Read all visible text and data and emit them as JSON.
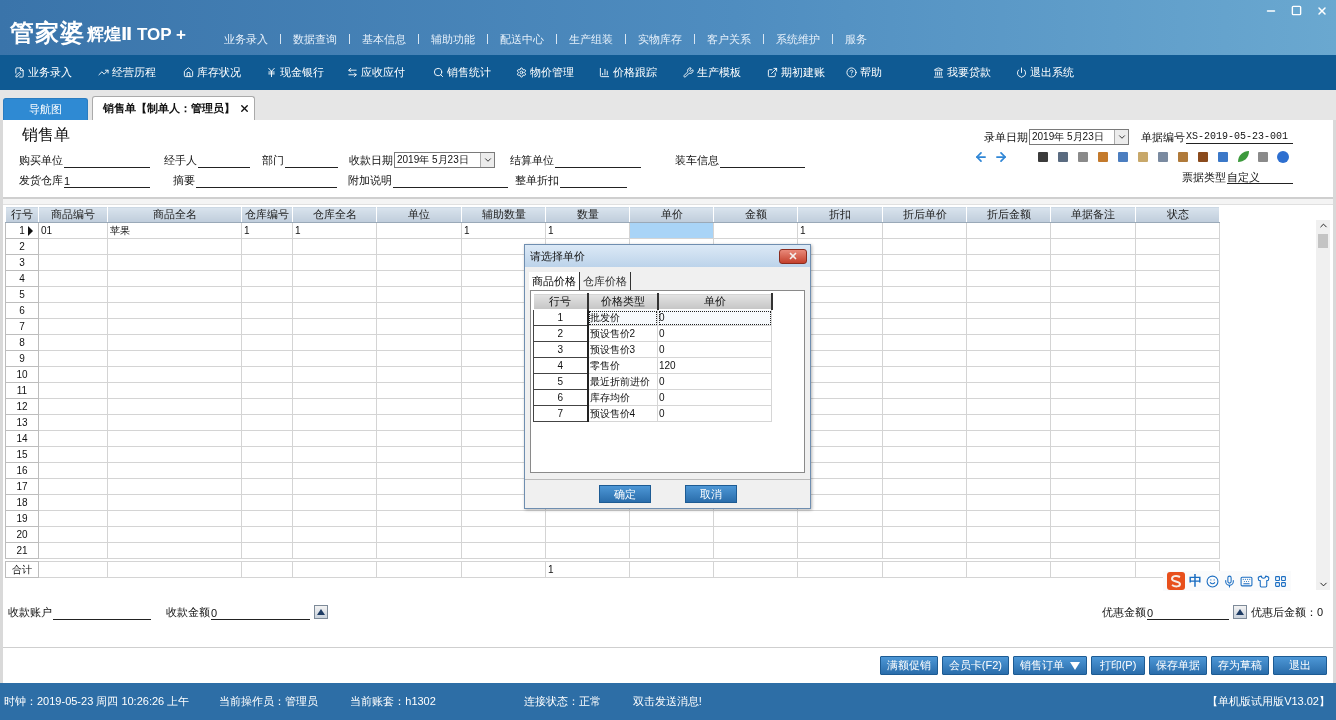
{
  "header": {
    "logo": "管家婆",
    "product": "辉煌Ⅱ TOP +",
    "menu": [
      "业务录入",
      "数据查询",
      "基本信息",
      "辅助功能",
      "配送中心",
      "生产组装",
      "实物库存",
      "客户关系",
      "系统维护",
      "服务"
    ]
  },
  "toolbar": [
    "业务录入",
    "经营历程",
    "库存状况",
    "现金银行",
    "应收应付",
    "销售统计",
    "物价管理",
    "价格跟踪",
    "生产模板",
    "期初建账",
    "帮助",
    "我要贷款",
    "退出系统"
  ],
  "tabs": [
    {
      "label": "导航图",
      "selected": false,
      "closable": false
    },
    {
      "label": "销售单【制单人：管理员】",
      "selected": true,
      "closable": true
    }
  ],
  "form": {
    "title": "销售单",
    "fields": [
      {
        "label": "购买单位",
        "kind": "line"
      },
      {
        "label": "经手人",
        "kind": "line"
      },
      {
        "label": "部门",
        "kind": "line"
      },
      {
        "label": "收款日期",
        "kind": "date",
        "value": "2019年 5月23日"
      },
      {
        "label": "结算单位",
        "kind": "line"
      },
      {
        "label": "装车信息",
        "kind": "line"
      },
      {
        "label": "发货仓库",
        "kind": "line",
        "value": "1"
      },
      {
        "label": "摘要",
        "kind": "line"
      },
      {
        "label": "附加说明",
        "kind": "line"
      },
      {
        "label": "整单折扣",
        "kind": "line"
      }
    ],
    "entry_date": {
      "label": "录单日期",
      "value": "2019年 5月23日"
    },
    "bill_number": {
      "label": "单据编号",
      "value": "XS-2019-05-23-001"
    },
    "bill_type": {
      "label": "票据类型",
      "value": "自定义"
    }
  },
  "grid": {
    "columns": [
      "行号",
      "商品编号",
      "商品全名",
      "仓库编号",
      "仓库全名",
      "单位",
      "辅助数量",
      "数量",
      "单价",
      "金额",
      "折扣",
      "折后单价",
      "折后金额",
      "单据备注",
      "状态"
    ],
    "rows": [
      {
        "number": "1",
        "current": true,
        "cells": [
          {
            "text": "01",
            "selected": false
          },
          {
            "text": "苹果",
            "selected": false
          },
          {
            "text": "1",
            "selected": false
          },
          {
            "text": "1",
            "selected": false
          },
          {
            "selected": false
          },
          {
            "text": "1",
            "selected": false
          },
          {
            "text": "1",
            "selected": false
          },
          {
            "selected": true
          },
          {
            "selected": false
          },
          {
            "text": "1",
            "selected": false
          },
          {
            "selected": false
          },
          {
            "selected": false
          },
          {
            "selected": false
          },
          {
            "selected": false
          }
        ]
      },
      {
        "number": "2",
        "current": false
      },
      {
        "number": "3",
        "current": false
      },
      {
        "number": "4",
        "current": false
      },
      {
        "number": "5",
        "current": false
      },
      {
        "number": "6",
        "current": false
      },
      {
        "number": "7",
        "current": false
      },
      {
        "number": "8",
        "current": false
      },
      {
        "number": "9",
        "current": false
      },
      {
        "number": "10",
        "current": false
      },
      {
        "number": "11",
        "current": false
      },
      {
        "number": "12",
        "current": false
      },
      {
        "number": "13",
        "current": false
      },
      {
        "number": "14",
        "current": false
      },
      {
        "number": "15",
        "current": false
      },
      {
        "number": "16",
        "current": false
      },
      {
        "number": "17",
        "current": false
      },
      {
        "number": "18",
        "current": false
      },
      {
        "number": "19",
        "current": false
      },
      {
        "number": "20",
        "current": false
      },
      {
        "number": "21",
        "current": false
      }
    ],
    "totals": {
      "label": "合计",
      "cells": [
        {},
        {},
        {},
        {},
        {},
        {},
        {
          "text": "1"
        },
        {},
        {},
        {},
        {},
        {},
        {},
        {}
      ]
    }
  },
  "payment": {
    "left": [
      {
        "label": "收款账户",
        "kind": "line"
      },
      {
        "label": "收款金额",
        "kind": "spin",
        "value": "0"
      }
    ],
    "right": [
      {
        "label": "优惠金额",
        "kind": "spin",
        "value": "0"
      },
      {
        "kind": "readout",
        "text": "优惠后金额：0"
      }
    ]
  },
  "buttons": [
    {
      "label": "满额促销",
      "dropdown": false
    },
    {
      "label": "会员卡(F2)",
      "dropdown": false
    },
    {
      "label": "销售订单",
      "dropdown": true
    },
    {
      "label": "打印(P)",
      "dropdown": false
    },
    {
      "label": "保存单据",
      "dropdown": false
    },
    {
      "label": "存为草稿",
      "dropdown": false
    },
    {
      "label": "退出",
      "dropdown": false
    }
  ],
  "status_bar": [
    "时钟：2019-05-23 周四 10:26:26 上午",
    "当前操作员：管理员",
    "当前账套：h1302",
    "连接状态：正常",
    "双击发送消息!"
  ],
  "edition": "【单机版试用版V13.02】",
  "ime": {
    "label": "中"
  },
  "dialog": {
    "title": "请选择单价",
    "tabs": [
      {
        "label": "商品价格",
        "selected": true
      },
      {
        "label": "仓库价格",
        "selected": false
      }
    ],
    "columns": [
      "行号",
      "价格类型",
      "单价"
    ],
    "rows": [
      {
        "number": "1",
        "type": "批发价",
        "price": "0",
        "selected": true
      },
      {
        "number": "2",
        "type": "预设售价2",
        "price": "0",
        "selected": false
      },
      {
        "number": "3",
        "type": "预设售价3",
        "price": "0",
        "selected": false
      },
      {
        "number": "4",
        "type": "零售价",
        "price": "120",
        "selected": false
      },
      {
        "number": "5",
        "type": "最近折前进价",
        "price": "0",
        "selected": false
      },
      {
        "number": "6",
        "type": "库存均价",
        "price": "0",
        "selected": false
      },
      {
        "number": "7",
        "type": "预设售价4",
        "price": "0",
        "selected": false
      }
    ],
    "buttons": [
      "确定",
      "取消"
    ]
  }
}
